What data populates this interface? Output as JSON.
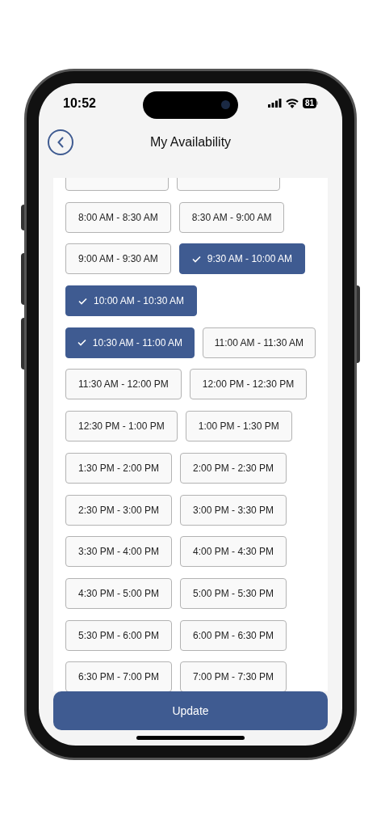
{
  "status_bar": {
    "time": "10:52",
    "battery": "81"
  },
  "header": {
    "title": "My Availability"
  },
  "slot_rows": [
    [
      {
        "selected": false
      },
      {
        "selected": false
      }
    ],
    [
      {
        "label": "8:00 AM - 8:30 AM",
        "selected": false
      },
      {
        "label": "8:30 AM - 9:00 AM",
        "selected": false
      }
    ],
    [
      {
        "label": "9:00 AM - 9:30 AM",
        "selected": false
      },
      {
        "label": "9:30 AM - 10:00 AM",
        "selected": true
      }
    ],
    [
      {
        "label": "10:00 AM - 10:30 AM",
        "selected": true
      }
    ],
    [
      {
        "label": "10:30 AM - 11:00 AM",
        "selected": true
      },
      {
        "label": "11:00 AM - 11:30 AM",
        "selected": false
      }
    ],
    [
      {
        "label": "11:30 AM - 12:00 PM",
        "selected": false
      },
      {
        "label": "12:00 PM - 12:30 PM",
        "selected": false
      }
    ],
    [
      {
        "label": "12:30 PM - 1:00 PM",
        "selected": false
      },
      {
        "label": "1:00 PM - 1:30 PM",
        "selected": false
      }
    ],
    [
      {
        "label": "1:30 PM - 2:00 PM",
        "selected": false
      },
      {
        "label": "2:00 PM - 2:30 PM",
        "selected": false
      }
    ],
    [
      {
        "label": "2:30 PM - 3:00 PM",
        "selected": false
      },
      {
        "label": "3:00 PM - 3:30 PM",
        "selected": false
      }
    ],
    [
      {
        "label": "3:30 PM - 4:00 PM",
        "selected": false
      },
      {
        "label": "4:00 PM - 4:30 PM",
        "selected": false
      }
    ],
    [
      {
        "label": "4:30 PM - 5:00 PM",
        "selected": false
      },
      {
        "label": "5:00 PM - 5:30 PM",
        "selected": false
      }
    ],
    [
      {
        "label": "5:30 PM - 6:00 PM",
        "selected": false
      },
      {
        "label": "6:00 PM - 6:30 PM",
        "selected": false
      }
    ],
    [
      {
        "label": "6:30 PM - 7:00 PM",
        "selected": false
      },
      {
        "label": "7:00 PM - 7:30 PM",
        "selected": false
      }
    ]
  ],
  "update_button": {
    "label": "Update"
  }
}
